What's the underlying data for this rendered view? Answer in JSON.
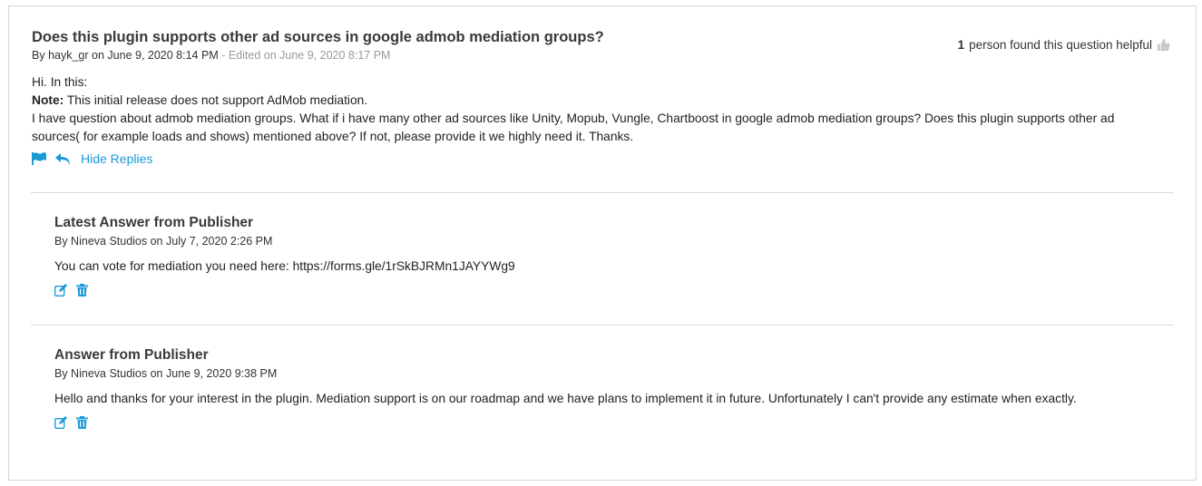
{
  "question": {
    "title": "Does this plugin supports other ad sources in google admob mediation groups?",
    "by_prefix": "By",
    "author": "hayk_gr",
    "date_prefix": "on June 9, 2020 8:14 PM",
    "edited": " - Edited on June 9, 2020 8:17 PM",
    "helpful_count": "1",
    "helpful_text": "person found this question helpful",
    "line1": "Hi. In this:",
    "note_label": "Note:",
    "note_text": " This initial release does not support AdMob mediation.",
    "paragraph": "I have question about admob mediation groups. What if i have many other ad sources like Unity, Mopub, Vungle, Chartboost in google admob mediation groups? Does this plugin supports other ad sources( for example loads and shows) mentioned above? If not, please provide it we highly need it. Thanks.",
    "hide_replies": "Hide Replies"
  },
  "replies": [
    {
      "title": "Latest Answer from Publisher",
      "meta": "By Nineva Studios on July 7, 2020 2:26 PM",
      "text": "You can vote for mediation you need here: https://forms.gle/1rSkBJRMn1JAYYWg9"
    },
    {
      "title": "Answer from Publisher",
      "meta": "By Nineva Studios on June 9, 2020 9:38 PM",
      "text": "Hello and thanks for your interest in the plugin. Mediation support is on our roadmap and we have plans to implement it in future. Unfortunately I can't provide any estimate when exactly."
    }
  ],
  "icons": {
    "flag": "flag-icon",
    "reply": "reply-icon",
    "thumb": "thumbs-up-icon",
    "edit": "edit-icon",
    "delete": "trash-icon"
  },
  "colors": {
    "accent": "#1a9bd7",
    "muted": "#9a9a9a",
    "border": "#d6d6d6"
  }
}
